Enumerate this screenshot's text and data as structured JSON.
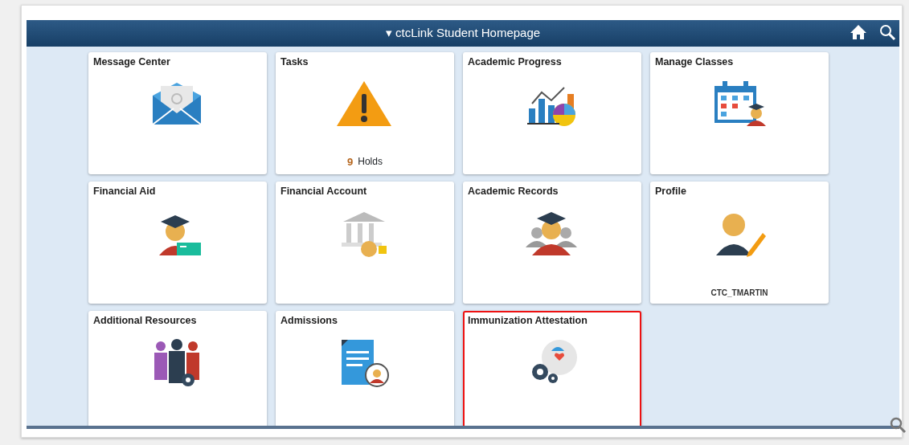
{
  "header": {
    "title": "ctcLink Student Homepage",
    "menu_glyph": "▾"
  },
  "tiles": [
    {
      "title": "Message Center",
      "highlighted": false
    },
    {
      "title": "Tasks",
      "count": "9",
      "count_label": "Holds",
      "highlighted": false
    },
    {
      "title": "Academic Progress",
      "highlighted": false
    },
    {
      "title": "Manage Classes",
      "highlighted": false
    },
    {
      "title": "Financial Aid",
      "highlighted": false
    },
    {
      "title": "Financial Account",
      "highlighted": false
    },
    {
      "title": "Academic Records",
      "highlighted": false
    },
    {
      "title": "Profile",
      "footer": "CTC_TMARTIN",
      "highlighted": false
    },
    {
      "title": "Additional Resources",
      "highlighted": false
    },
    {
      "title": "Admissions",
      "highlighted": false
    },
    {
      "title": "Immunization Attestation",
      "highlighted": true
    }
  ]
}
